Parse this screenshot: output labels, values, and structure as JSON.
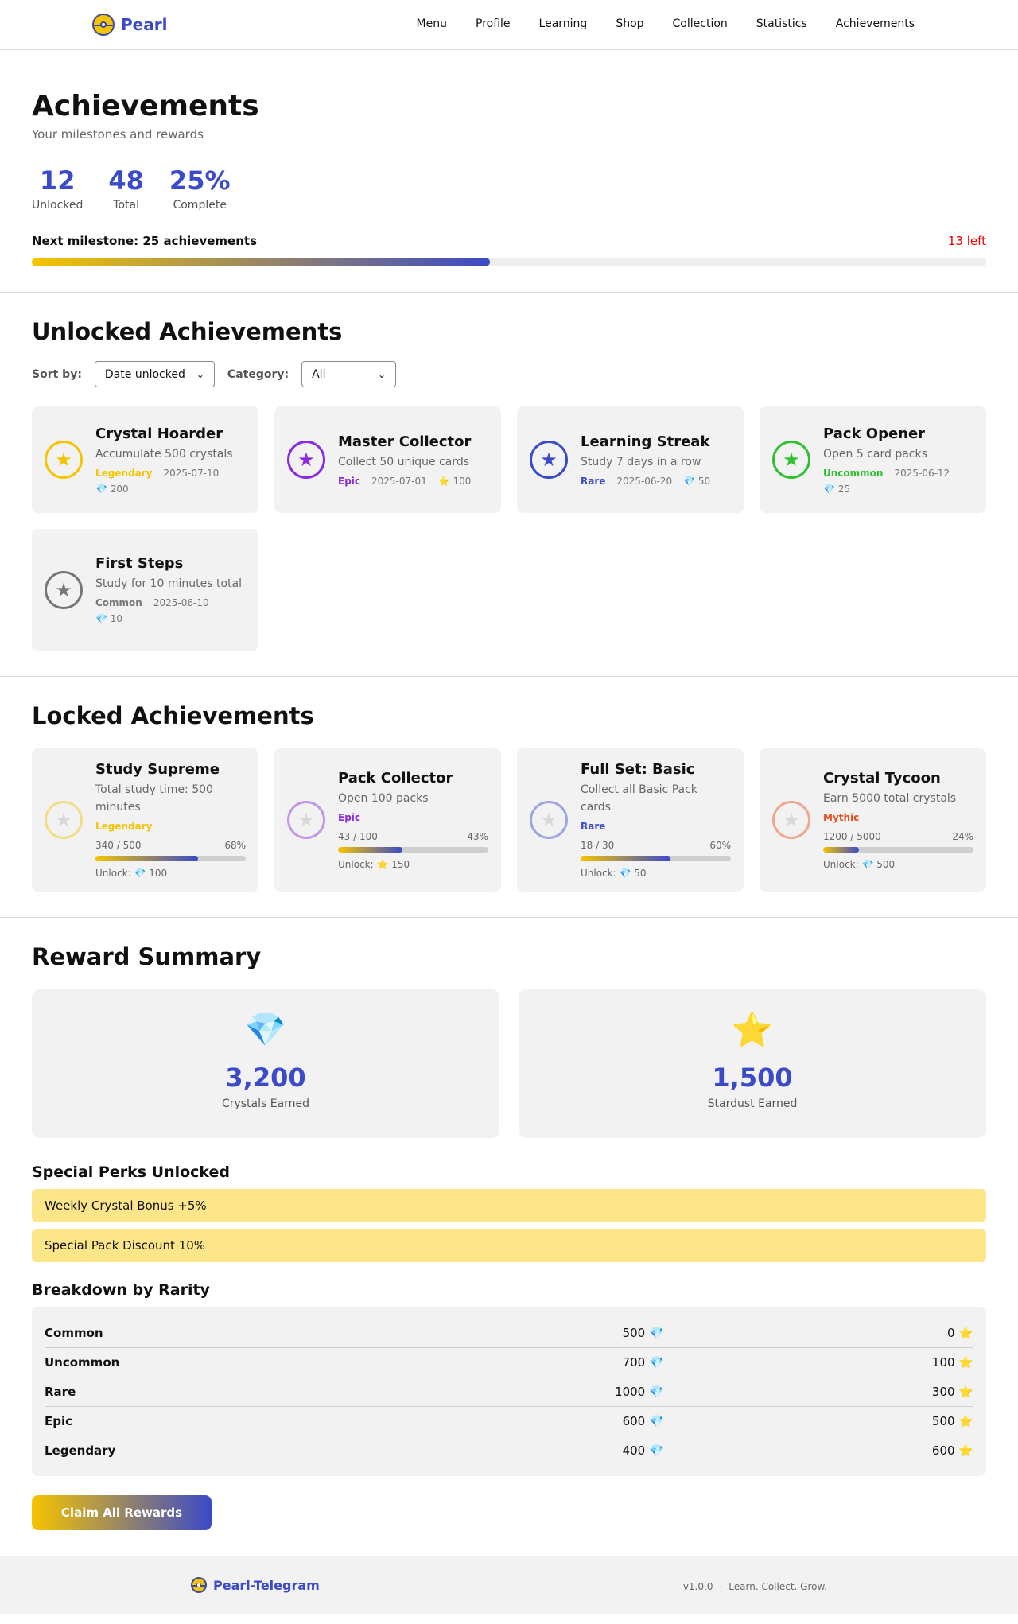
{
  "nav": {
    "brand": "Pearl",
    "links": [
      "Menu",
      "Profile",
      "Learning",
      "Shop",
      "Collection",
      "Statistics",
      "Achievements"
    ]
  },
  "hero": {
    "title": "Achievements",
    "subtitle": "Your milestones and rewards",
    "stats": [
      {
        "value": "12",
        "label": "Unlocked"
      },
      {
        "value": "48",
        "label": "Total"
      },
      {
        "value": "25%",
        "label": "Complete"
      }
    ],
    "milestone_label": "Next milestone: 25 achievements",
    "milestone_left": "13 left",
    "milestone_progress": 0.48
  },
  "unlocked": {
    "title": "Unlocked Achievements",
    "sort_label": "Sort by:",
    "sort_value": "Date unlocked",
    "category_label": "Category:",
    "category_value": "All",
    "items": [
      {
        "title": "Crystal Hoarder",
        "desc": "Accumulate 500 crystals",
        "rarity": "Legendary",
        "date": "2025-07-10",
        "reward": "💎 200",
        "color": "#f5c400"
      },
      {
        "title": "Master Collector",
        "desc": "Collect 50 unique cards",
        "rarity": "Epic",
        "date": "2025-07-01",
        "reward": "⭐ 100",
        "color": "#8a2be2"
      },
      {
        "title": "Learning Streak",
        "desc": "Study 7 days in a row",
        "rarity": "Rare",
        "date": "2025-06-20",
        "reward": "💎 50",
        "color": "#3b4ac8"
      },
      {
        "title": "Pack Opener",
        "desc": "Open 5 card packs",
        "rarity": "Uncommon",
        "date": "2025-06-12",
        "reward": "💎 25",
        "color": "#2ec02e"
      },
      {
        "title": "First Steps",
        "desc": "Study for 10 minutes total",
        "rarity": "Common",
        "date": "2025-06-10",
        "reward": "💎 10",
        "color": "#777777"
      }
    ]
  },
  "locked": {
    "title": "Locked Achievements",
    "items": [
      {
        "title": "Study Supreme",
        "desc": "Total study time: 500 minutes",
        "rarity": "Legendary",
        "progress_text": "340 / 500",
        "percent": "68%",
        "progress": 0.68,
        "unlock": "Unlock: 💎 100",
        "color": "#f5c400"
      },
      {
        "title": "Pack Collector",
        "desc": "Open 100 packs",
        "rarity": "Epic",
        "progress_text": "43 / 100",
        "percent": "43%",
        "progress": 0.43,
        "unlock": "Unlock: ⭐ 150",
        "color": "#8a2be2"
      },
      {
        "title": "Full Set: Basic",
        "desc": "Collect all Basic Pack cards",
        "rarity": "Rare",
        "progress_text": "18 / 30",
        "percent": "60%",
        "progress": 0.6,
        "unlock": "Unlock: 💎 50",
        "color": "#3b4ac8"
      },
      {
        "title": "Crystal Tycoon",
        "desc": "Earn 5000 total crystals",
        "rarity": "Mythic",
        "progress_text": "1200 / 5000",
        "percent": "24%",
        "progress": 0.24,
        "unlock": "Unlock: 💎 500",
        "color": "#e8501e"
      }
    ]
  },
  "rewards": {
    "title": "Reward Summary",
    "crystals": {
      "icon": "💎",
      "value": "3,200",
      "label": "Crystals Earned"
    },
    "stardust": {
      "icon": "⭐",
      "value": "1,500",
      "label": "Stardust Earned"
    },
    "perks_title": "Special Perks Unlocked",
    "perks": [
      "Weekly Crystal Bonus +5%",
      "Special Pack Discount 10%"
    ],
    "breakdown_title": "Breakdown by Rarity",
    "breakdown": [
      {
        "rarity": "Common",
        "crystals": "500 💎",
        "stardust": "0 ⭐"
      },
      {
        "rarity": "Uncommon",
        "crystals": "700 💎",
        "stardust": "100 ⭐"
      },
      {
        "rarity": "Rare",
        "crystals": "1000 💎",
        "stardust": "300 ⭐"
      },
      {
        "rarity": "Epic",
        "crystals": "600 💎",
        "stardust": "500 ⭐"
      },
      {
        "rarity": "Legendary",
        "crystals": "400 💎",
        "stardust": "600 ⭐"
      }
    ],
    "claim_label": "Claim All Rewards"
  },
  "footer": {
    "brand": "Pearl-Telegram",
    "version": "v1.0.0",
    "sep": "·",
    "tagline": "Learn. Collect. Grow."
  }
}
